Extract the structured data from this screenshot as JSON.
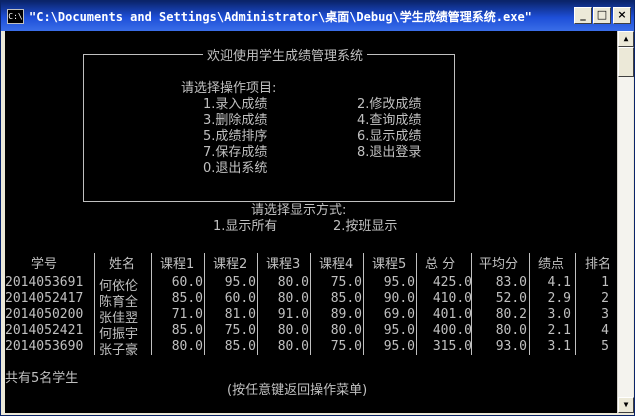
{
  "window": {
    "title": "\"C:\\Documents and Settings\\Administrator\\桌面\\Debug\\学生成绩管理系统.exe\"",
    "icon_label": "C:\\",
    "buttons": {
      "minimize": "_",
      "maximize": "□",
      "close": "×"
    }
  },
  "menu": {
    "title": "欢迎使用学生成绩管理系统",
    "prompt": "请选择操作项目:",
    "items": [
      "1.录入成绩",
      "2.修改成绩",
      "3.删除成绩",
      "4.查询成绩",
      "5.成绩排序",
      "6.显示成绩",
      "7.保存成绩",
      "8.退出登录",
      "0.退出系统"
    ]
  },
  "display_mode": {
    "prompt": "请选择显示方式:",
    "option_all": "1.显示所有",
    "option_class": "2.按班显示"
  },
  "table": {
    "headers": [
      "学号",
      "姓名",
      "课程1",
      "课程2",
      "课程3",
      "课程4",
      "课程5",
      "总 分",
      "平均分",
      "绩点",
      "排名"
    ],
    "rows": [
      [
        "2014053691",
        "何依伦",
        "60.0",
        "95.0",
        "80.0",
        "75.0",
        "95.0",
        "425.0",
        "83.0",
        "4.1",
        "1"
      ],
      [
        "2014052417",
        "陈育全",
        "85.0",
        "60.0",
        "80.0",
        "85.0",
        "90.0",
        "410.0",
        "52.0",
        "2.9",
        "2"
      ],
      [
        "2014050200",
        "张佳翌",
        "71.0",
        "81.0",
        "91.0",
        "89.0",
        "69.0",
        "401.0",
        "80.2",
        "3.0",
        "3"
      ],
      [
        "2014052421",
        "何振宇",
        "85.0",
        "75.0",
        "80.0",
        "80.0",
        "95.0",
        "400.0",
        "80.0",
        "2.1",
        "4"
      ],
      [
        "2014053690",
        "张子豪",
        "80.0",
        "85.0",
        "80.0",
        "75.0",
        "95.0",
        "315.0",
        "93.0",
        "3.1",
        "5"
      ]
    ]
  },
  "footer": {
    "count": "共有5名学生",
    "return_hint": "(按任意键返回操作菜单)"
  },
  "colors": {
    "console_bg": "#000000",
    "console_fg": "#c0c0c0",
    "titlebar": "#0a246a"
  }
}
